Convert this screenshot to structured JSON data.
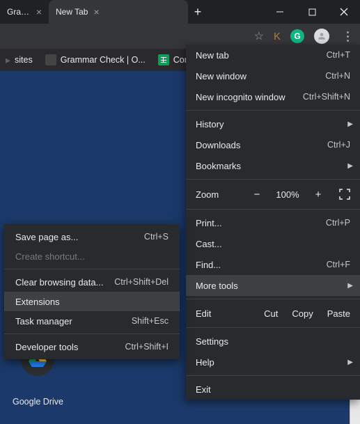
{
  "tabs": {
    "inactive": "Gramma",
    "active": "New Tab"
  },
  "bookmarks": {
    "sites": "sites",
    "grammar": "Grammar Check | O...",
    "conte": "Conte"
  },
  "menu": {
    "newTab": {
      "label": "New tab",
      "shortcut": "Ctrl+T"
    },
    "newWindow": {
      "label": "New window",
      "shortcut": "Ctrl+N"
    },
    "newIncognito": {
      "label": "New incognito window",
      "shortcut": "Ctrl+Shift+N"
    },
    "history": "History",
    "downloads": {
      "label": "Downloads",
      "shortcut": "Ctrl+J"
    },
    "bookmarks": "Bookmarks",
    "zoom": {
      "label": "Zoom",
      "value": "100%"
    },
    "print": {
      "label": "Print...",
      "shortcut": "Ctrl+P"
    },
    "cast": "Cast...",
    "find": {
      "label": "Find...",
      "shortcut": "Ctrl+F"
    },
    "moreTools": "More tools",
    "edit": {
      "label": "Edit",
      "cut": "Cut",
      "copy": "Copy",
      "paste": "Paste"
    },
    "settings": "Settings",
    "help": "Help",
    "exit": "Exit"
  },
  "submenu": {
    "savePage": {
      "label": "Save page as...",
      "shortcut": "Ctrl+S"
    },
    "createShortcut": "Create shortcut...",
    "clearBrowsing": {
      "label": "Clear browsing data...",
      "shortcut": "Ctrl+Shift+Del"
    },
    "extensions": "Extensions",
    "taskManager": {
      "label": "Task manager",
      "shortcut": "Shift+Esc"
    },
    "devTools": {
      "label": "Developer tools",
      "shortcut": "Ctrl+Shift+I"
    }
  },
  "drive": "Google Drive"
}
